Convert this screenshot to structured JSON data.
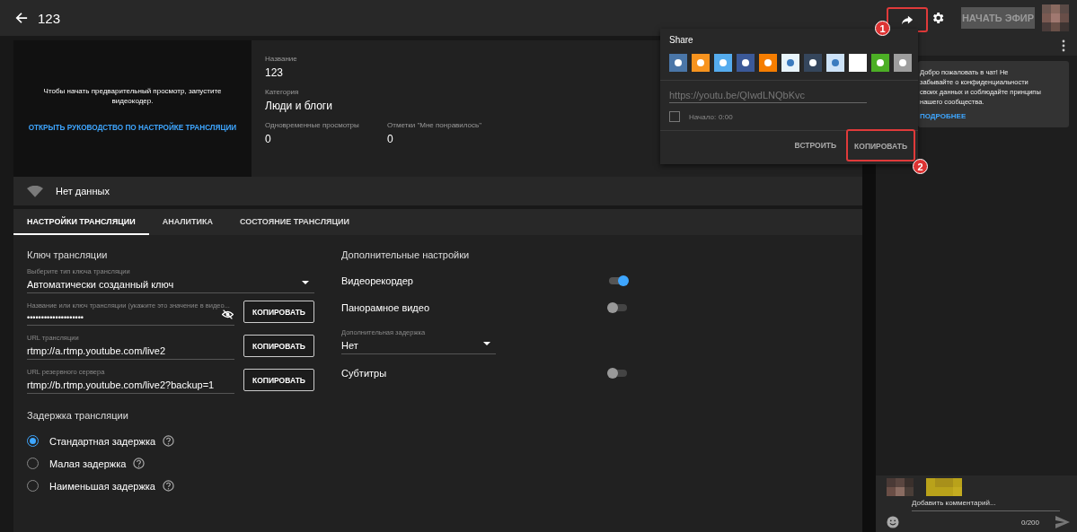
{
  "header": {
    "title": "123",
    "go_live_button": "НАЧАТЬ ЭФИР",
    "go_live_disabled": true
  },
  "preview": {
    "message": "Чтобы начать предварительный просмотр, запустите видеокодер.",
    "guide_link": "ОТКРЫТЬ РУКОВОДСТВО ПО НАСТРОЙКЕ ТРАНСЛЯЦИИ"
  },
  "info": {
    "title_label": "Название",
    "title_value": "123",
    "category_label": "Категория",
    "category_value": "Люди и блоги",
    "stats": [
      {
        "label": "Одновременные просмотры",
        "value": "0"
      },
      {
        "label": "Отметки \"Мне понравилось\"",
        "value": "0"
      }
    ]
  },
  "status": {
    "text": "Нет данных"
  },
  "tabs": [
    {
      "label": "НАСТРОЙКИ ТРАНСЛЯЦИИ",
      "selected": true
    },
    {
      "label": "АНАЛИТИКА",
      "selected": false
    },
    {
      "label": "СОСТОЯНИЕ ТРАНСЛЯЦИИ",
      "selected": false
    }
  ],
  "stream_key": {
    "heading": "Ключ трансляции",
    "key_type": {
      "label": "Выберите тип ключа трансляции",
      "value": "Автоматически созданный ключ"
    },
    "fields": [
      {
        "label": "Название или ключ трансляции (укажите это значение в видео...",
        "value": "••••••••••••••••••••",
        "kind": "secret",
        "button": "КОПИРОВАТЬ"
      },
      {
        "label": "URL трансляции",
        "value": "rtmp://a.rtmp.youtube.com/live2",
        "kind": "text",
        "button": "КОПИРОВАТЬ"
      },
      {
        "label": "URL резервного сервера",
        "value": "rtmp://b.rtmp.youtube.com/live2?backup=1",
        "kind": "text",
        "button": "КОПИРОВАТЬ"
      }
    ]
  },
  "latency": {
    "heading": "Задержка трансляции",
    "options": [
      {
        "label": "Стандартная задержка",
        "selected": true
      },
      {
        "label": "Малая задержка",
        "selected": false
      },
      {
        "label": "Наименьшая задержка",
        "selected": false
      }
    ]
  },
  "extra": {
    "heading": "Дополнительные настройки",
    "items": [
      {
        "kind": "switch",
        "label": "Видеорекордер",
        "on": true
      },
      {
        "kind": "switch",
        "label": "Панорамное видео",
        "on": false
      },
      {
        "kind": "select",
        "label": "Дополнительная задержка",
        "value": "Нет"
      },
      {
        "kind": "switch",
        "label": "Субтитры",
        "on": false
      }
    ]
  },
  "share": {
    "title": "Share",
    "services": [
      {
        "color": "#4a76a8"
      },
      {
        "color": "#f7931e"
      },
      {
        "color": "#55acee"
      },
      {
        "color": "#3b5998"
      },
      {
        "color": "#f57d00"
      },
      {
        "color": "#e8f4fb"
      },
      {
        "color": "#35465c"
      },
      {
        "color": "#cee3f8"
      },
      {
        "color": "#ffffff"
      },
      {
        "color": "#4caf25"
      },
      {
        "color": "#9e9e9e"
      }
    ],
    "url": "https://youtu.be/QIwdLNQbKvc",
    "start_checked": false,
    "start_label": "Начало:",
    "start_time": "0:00",
    "embed_button": "ВСТРОИТЬ",
    "copy_button": "КОПИРОВАТЬ"
  },
  "annotations": [
    {
      "number": "1"
    },
    {
      "number": "2"
    }
  ],
  "chat": {
    "welcome_lines": [
      "Добро пожаловать в чат! Не",
      "забывайте о конфиденциальности",
      "своих данных и соблюдайте принципы",
      "нашего сообщества."
    ],
    "more_link": "ПОДРОБНЕЕ",
    "comment_placeholder": "Добавить комментарий...",
    "counter": "0/200"
  }
}
